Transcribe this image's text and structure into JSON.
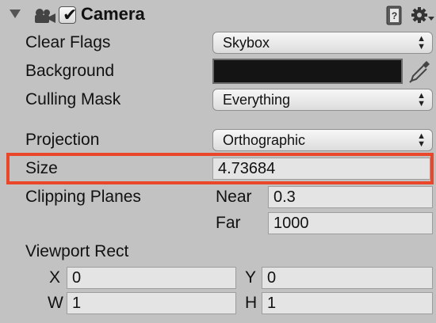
{
  "header": {
    "title": "Camera",
    "enabled": true,
    "icons": [
      "fold-arrow-icon",
      "camera-icon",
      "help-book-icon",
      "gear-icon"
    ]
  },
  "fields": {
    "clear_flags": {
      "label": "Clear Flags",
      "value": "Skybox"
    },
    "background": {
      "label": "Background",
      "color": "#141414"
    },
    "culling_mask": {
      "label": "Culling Mask",
      "value": "Everything"
    },
    "projection": {
      "label": "Projection",
      "value": "Orthographic"
    },
    "size": {
      "label": "Size",
      "value": "4.73684"
    },
    "clipping_planes": {
      "label": "Clipping Planes",
      "near_label": "Near",
      "near": "0.3",
      "far_label": "Far",
      "far": "1000"
    },
    "viewport_rect": {
      "label": "Viewport Rect",
      "x_label": "X",
      "x": "0",
      "y_label": "Y",
      "y": "0",
      "w_label": "W",
      "w": "1",
      "h_label": "H",
      "h": "1"
    }
  },
  "colors": {
    "panel_bg": "#c2c2c2",
    "highlight_border": "#e9462a"
  }
}
